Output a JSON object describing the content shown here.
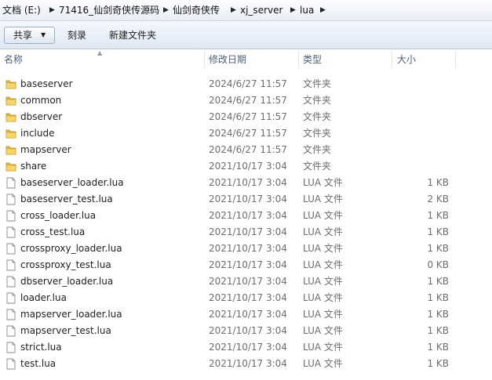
{
  "breadcrumb": [
    "文档 (E:)",
    "71416_仙剑奇侠传源码",
    "仙剑奇侠传",
    "xj_server",
    "lua"
  ],
  "toolbar": {
    "share_label": "共享",
    "burn_label": "刻录",
    "new_folder_label": "新建文件夹"
  },
  "columns": {
    "name": "名称",
    "date": "修改日期",
    "type": "类型",
    "size": "大小"
  },
  "files": [
    {
      "name": "baseserver",
      "date": "2024/6/27 11:57",
      "type": "文件夹",
      "size": "",
      "kind": "folder"
    },
    {
      "name": "common",
      "date": "2024/6/27 11:57",
      "type": "文件夹",
      "size": "",
      "kind": "folder"
    },
    {
      "name": "dbserver",
      "date": "2024/6/27 11:57",
      "type": "文件夹",
      "size": "",
      "kind": "folder"
    },
    {
      "name": "include",
      "date": "2024/6/27 11:57",
      "type": "文件夹",
      "size": "",
      "kind": "folder"
    },
    {
      "name": "mapserver",
      "date": "2024/6/27 11:57",
      "type": "文件夹",
      "size": "",
      "kind": "folder"
    },
    {
      "name": "share",
      "date": "2021/10/17 3:04",
      "type": "文件夹",
      "size": "",
      "kind": "folder"
    },
    {
      "name": "baseserver_loader.lua",
      "date": "2021/10/17 3:04",
      "type": "LUA 文件",
      "size": "1 KB",
      "kind": "file"
    },
    {
      "name": "baseserver_test.lua",
      "date": "2021/10/17 3:04",
      "type": "LUA 文件",
      "size": "2 KB",
      "kind": "file"
    },
    {
      "name": "cross_loader.lua",
      "date": "2021/10/17 3:04",
      "type": "LUA 文件",
      "size": "1 KB",
      "kind": "file"
    },
    {
      "name": "cross_test.lua",
      "date": "2021/10/17 3:04",
      "type": "LUA 文件",
      "size": "1 KB",
      "kind": "file"
    },
    {
      "name": "crossproxy_loader.lua",
      "date": "2021/10/17 3:04",
      "type": "LUA 文件",
      "size": "1 KB",
      "kind": "file"
    },
    {
      "name": "crossproxy_test.lua",
      "date": "2021/10/17 3:04",
      "type": "LUA 文件",
      "size": "0 KB",
      "kind": "file"
    },
    {
      "name": "dbserver_loader.lua",
      "date": "2021/10/17 3:04",
      "type": "LUA 文件",
      "size": "1 KB",
      "kind": "file"
    },
    {
      "name": "loader.lua",
      "date": "2021/10/17 3:04",
      "type": "LUA 文件",
      "size": "1 KB",
      "kind": "file"
    },
    {
      "name": "mapserver_loader.lua",
      "date": "2021/10/17 3:04",
      "type": "LUA 文件",
      "size": "1 KB",
      "kind": "file"
    },
    {
      "name": "mapserver_test.lua",
      "date": "2021/10/17 3:04",
      "type": "LUA 文件",
      "size": "1 KB",
      "kind": "file"
    },
    {
      "name": "strict.lua",
      "date": "2021/10/17 3:04",
      "type": "LUA 文件",
      "size": "1 KB",
      "kind": "file"
    },
    {
      "name": "test.lua",
      "date": "2021/10/17 3:04",
      "type": "LUA 文件",
      "size": "1 KB",
      "kind": "file"
    }
  ],
  "icons": {
    "folder": "folder-icon",
    "file": "file-icon",
    "separator": "chevron-right-icon",
    "dropdown": "chevron-down-icon",
    "sort": "sort-ascending-icon"
  },
  "colors": {
    "folder": "#e8b935",
    "header_text": "#4c607a",
    "meta_text": "#6d6d6d"
  }
}
